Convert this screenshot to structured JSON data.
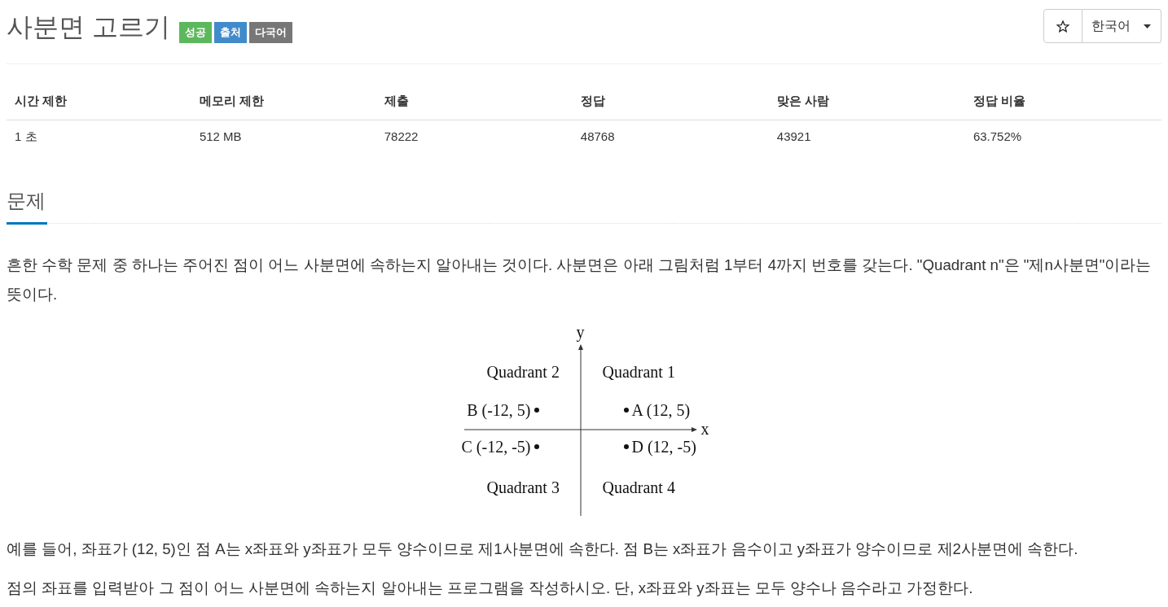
{
  "title": "사분면 고르기",
  "badges": [
    {
      "label": "성공",
      "color": "#5cb85c"
    },
    {
      "label": "출처",
      "color": "#428bca"
    },
    {
      "label": "다국어",
      "color": "#777777"
    }
  ],
  "language_dropdown": {
    "value": "한국어"
  },
  "stats_table": {
    "columns": [
      "시간 제한",
      "메모리 제한",
      "제출",
      "정답",
      "맞은 사람",
      "정답 비율"
    ],
    "rows": [
      [
        "1 초",
        "512 MB",
        "78222",
        "48768",
        "43921",
        "63.752%"
      ]
    ]
  },
  "problem": {
    "heading": "문제",
    "blocks": [
      {
        "kind": "paragraph",
        "text": "흔한 수학 문제 중 하나는 주어진 점이 어느 사분면에 속하는지 알아내는 것이다. 사분면은 아래 그림처럼 1부터 4까지 번호를 갖는다. \"Quadrant n\"은 \"제n사분면\"이라는 뜻이다."
      },
      {
        "kind": "figure",
        "y_axis_label": "y",
        "x_axis_label": "x",
        "quadrants": [
          "Quadrant 2",
          "Quadrant 1",
          "Quadrant 3",
          "Quadrant 4"
        ],
        "points": [
          "B (-12, 5)",
          "A (12, 5)",
          "C (-12, -5)",
          "D (12, -5)"
        ]
      },
      {
        "kind": "paragraph",
        "text": "예를 들어, 좌표가 (12, 5)인 점 A는 x좌표와 y좌표가 모두 양수이므로 제1사분면에 속한다. 점 B는 x좌표가 음수이고 y좌표가 양수이므로 제2사분면에 속한다."
      },
      {
        "kind": "paragraph",
        "text": "점의 좌표를 입력받아 그 점이 어느 사분면에 속하는지 알아내는 프로그램을 작성하시오. 단, x좌표와 y좌표는 모두 양수나 음수라고 가정한다."
      }
    ]
  }
}
